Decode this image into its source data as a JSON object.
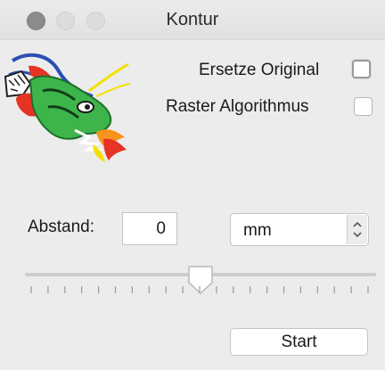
{
  "window": {
    "title": "Kontur"
  },
  "logo": {
    "icon": "dragon-logo-icon"
  },
  "options": {
    "replace_original_label": "Ersetze Original",
    "replace_original_checked": false,
    "raster_algorithm_label": "Raster Algorithmus",
    "raster_algorithm_checked": false
  },
  "distance": {
    "label": "Abstand:",
    "value": "0",
    "unit": "mm"
  },
  "slider": {
    "value_fraction": 0.5,
    "tick_count": 21
  },
  "actions": {
    "start_label": "Start"
  },
  "colors": {
    "window_bg": "#ececec",
    "close_button": "#8b8b8b",
    "dragon_green": "#3db54a",
    "dragon_red": "#e53324",
    "dragon_blue": "#2a4fb3",
    "dragon_yellow": "#f4e000"
  }
}
